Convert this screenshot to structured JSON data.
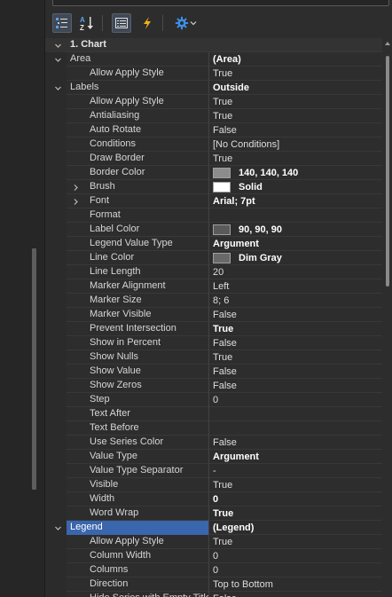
{
  "toolbar": {
    "buttons": [
      {
        "name": "categorized-icon",
        "active": true
      },
      {
        "name": "sort-alphabetical-icon",
        "active": false
      },
      {
        "name": "property-pages-icon",
        "active": true
      },
      {
        "name": "events-lightning-icon",
        "active": false
      },
      {
        "name": "settings-gear-icon",
        "active": false
      }
    ]
  },
  "colors": {
    "accent": "#3a66ad",
    "lightning": "#f3b316",
    "gear": "#3d8ee6",
    "sort_a": "#5aa1e8",
    "sort_z": "#e8e8e8"
  },
  "grid": {
    "rows": [
      {
        "kind": "category",
        "label": "1. Chart",
        "expanded": true
      },
      {
        "kind": "prop",
        "level": 0,
        "name": "Area",
        "value": "(Area)",
        "bold": true,
        "expand": "expanded"
      },
      {
        "kind": "prop",
        "level": 1,
        "name": "Allow Apply Style",
        "value": "True"
      },
      {
        "kind": "prop",
        "level": 0,
        "name": "Labels",
        "value": "Outside",
        "bold": true,
        "expand": "expanded"
      },
      {
        "kind": "prop",
        "level": 1,
        "name": "Allow Apply Style",
        "value": "True"
      },
      {
        "kind": "prop",
        "level": 1,
        "name": "Antialiasing",
        "value": "True"
      },
      {
        "kind": "prop",
        "level": 1,
        "name": "Auto Rotate",
        "value": "False"
      },
      {
        "kind": "prop",
        "level": 1,
        "name": "Conditions",
        "value": "[No Conditions]"
      },
      {
        "kind": "prop",
        "level": 1,
        "name": "Draw Border",
        "value": "True"
      },
      {
        "kind": "prop",
        "level": 1,
        "name": "Border Color",
        "value": "140, 140, 140",
        "bold": true,
        "swatch": "#8c8c8c"
      },
      {
        "kind": "prop",
        "level": 1,
        "name": "Brush",
        "value": "Solid",
        "bold": true,
        "swatch": "#ffffff",
        "expand": "collapsed"
      },
      {
        "kind": "prop",
        "level": 1,
        "name": "Font",
        "value": "Arial; 7pt",
        "bold": true,
        "expand": "collapsed"
      },
      {
        "kind": "prop",
        "level": 1,
        "name": "Format",
        "value": ""
      },
      {
        "kind": "prop",
        "level": 1,
        "name": "Label Color",
        "value": "90, 90, 90",
        "bold": true,
        "swatch": "#5a5a5a"
      },
      {
        "kind": "prop",
        "level": 1,
        "name": "Legend Value Type",
        "value": "Argument",
        "bold": true
      },
      {
        "kind": "prop",
        "level": 1,
        "name": "Line Color",
        "value": "Dim Gray",
        "bold": true,
        "swatch": "#696969"
      },
      {
        "kind": "prop",
        "level": 1,
        "name": "Line Length",
        "value": "20"
      },
      {
        "kind": "prop",
        "level": 1,
        "name": "Marker Alignment",
        "value": "Left"
      },
      {
        "kind": "prop",
        "level": 1,
        "name": "Marker Size",
        "value": "8; 6"
      },
      {
        "kind": "prop",
        "level": 1,
        "name": "Marker Visible",
        "value": "False"
      },
      {
        "kind": "prop",
        "level": 1,
        "name": "Prevent Intersection",
        "value": "True",
        "bold": true
      },
      {
        "kind": "prop",
        "level": 1,
        "name": "Show in Percent",
        "value": "False"
      },
      {
        "kind": "prop",
        "level": 1,
        "name": "Show Nulls",
        "value": "True"
      },
      {
        "kind": "prop",
        "level": 1,
        "name": "Show Value",
        "value": "False"
      },
      {
        "kind": "prop",
        "level": 1,
        "name": "Show Zeros",
        "value": "False"
      },
      {
        "kind": "prop",
        "level": 1,
        "name": "Step",
        "value": "0"
      },
      {
        "kind": "prop",
        "level": 1,
        "name": "Text After",
        "value": ""
      },
      {
        "kind": "prop",
        "level": 1,
        "name": "Text Before",
        "value": ""
      },
      {
        "kind": "prop",
        "level": 1,
        "name": "Use Series Color",
        "value": "False"
      },
      {
        "kind": "prop",
        "level": 1,
        "name": "Value Type",
        "value": "Argument",
        "bold": true
      },
      {
        "kind": "prop",
        "level": 1,
        "name": "Value Type Separator",
        "value": "-"
      },
      {
        "kind": "prop",
        "level": 1,
        "name": "Visible",
        "value": "True"
      },
      {
        "kind": "prop",
        "level": 1,
        "name": "Width",
        "value": "0",
        "bold": true
      },
      {
        "kind": "prop",
        "level": 1,
        "name": "Word Wrap",
        "value": "True",
        "bold": true
      },
      {
        "kind": "prop",
        "level": 0,
        "name": "Legend",
        "value": "(Legend)",
        "bold": true,
        "expand": "expanded",
        "selected": true
      },
      {
        "kind": "prop",
        "level": 1,
        "name": "Allow Apply Style",
        "value": "True"
      },
      {
        "kind": "prop",
        "level": 1,
        "name": "Column Width",
        "value": "0"
      },
      {
        "kind": "prop",
        "level": 1,
        "name": "Columns",
        "value": "0"
      },
      {
        "kind": "prop",
        "level": 1,
        "name": "Direction",
        "value": "Top to Bottom"
      },
      {
        "kind": "prop",
        "level": 1,
        "name": "Hide Series with Empty Title",
        "value": "False"
      }
    ]
  }
}
